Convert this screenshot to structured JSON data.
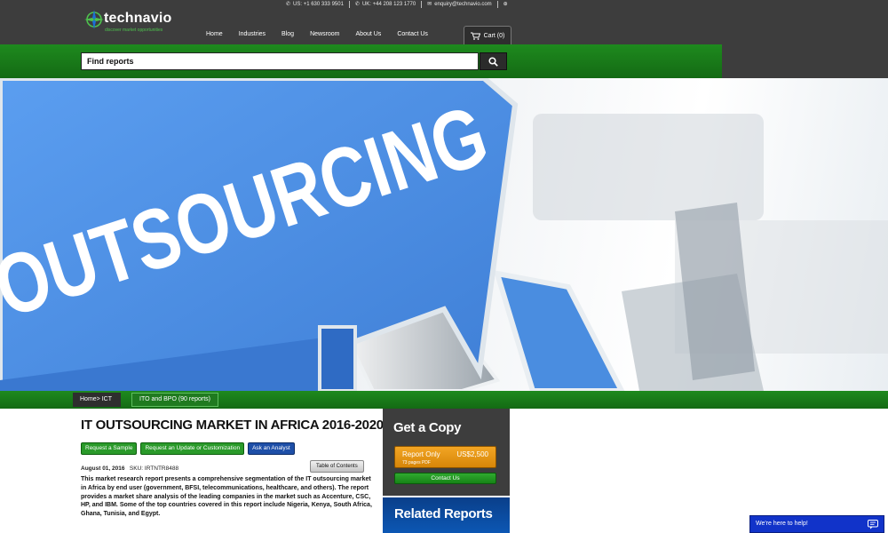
{
  "topbar": {
    "phone_us": "US: +1 630 333 9501",
    "phone_uk": "UK: +44 208 123 1770",
    "email": "enquiry@technavio.com"
  },
  "logo": {
    "name": "technavio",
    "tagline": "discover market opportunities"
  },
  "nav": {
    "items": [
      "Home",
      "Industries",
      "Blog",
      "Newsroom",
      "About Us",
      "Contact Us"
    ]
  },
  "cart": {
    "label": "Cart (0)"
  },
  "search": {
    "placeholder": "Find reports"
  },
  "hero": {
    "text": "OUTSOURCING",
    "accent": "#4a8de0"
  },
  "breadcrumb": {
    "first": "Home> ICT",
    "second": "ITO and BPO (90 reports)"
  },
  "report": {
    "title": "IT OUTSOURCING MARKET IN AFRICA 2016-2020",
    "buttons": [
      "Request a Sample",
      "Request an Update or Customization",
      "Ask an Analyst"
    ],
    "date": "August 01, 2016",
    "sku": "SKU: IRTNTR8488",
    "toc": "Table of Contents",
    "description": "This market research report presents a comprehensive segmentation of the IT outsourcing market in Africa by end user (government, BFSI, telecommunications, healthcare, and others). The report provides a market share analysis of the leading companies in the market such as Accenture, CSC, HP, and IBM. Some of the top countries covered in this report include Nigeria, Kenya, South Africa, Ghana, Tunisia, and Egypt."
  },
  "purchase": {
    "title": "Get a Copy",
    "option_label": "Report Only",
    "price": "US$2,500",
    "sub": "73 pages PDF",
    "contact": "Contact Us"
  },
  "related": {
    "title": "Related Reports"
  },
  "chat": {
    "label": "We're here to help!"
  },
  "colors": {
    "header": "#3d3d3d",
    "green": "#1e8a1e",
    "orange": "#e8961a",
    "blue": "#1133c9"
  }
}
